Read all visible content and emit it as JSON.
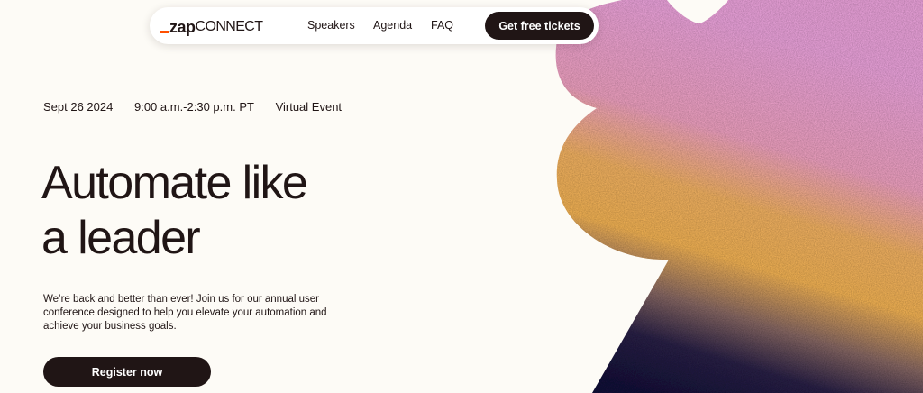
{
  "nav": {
    "logo": {
      "prefix": "zap",
      "suffix": "CONNECT"
    },
    "links": [
      {
        "label": "Speakers"
      },
      {
        "label": "Agenda"
      },
      {
        "label": "FAQ"
      }
    ],
    "cta_label": "Get free tickets"
  },
  "event": {
    "date": "Sept 26 2024",
    "time": "9:00 a.m.-2:30 p.m. PT",
    "format": "Virtual Event"
  },
  "hero": {
    "headline_line1": "Automate like",
    "headline_line2": "a leader",
    "description": "We’re back and better than ever! Join us for our annual user conference designed to help you elevate your automation and achieve your business goals.",
    "register_label": "Register now"
  },
  "colors": {
    "background": "#fdfbf6",
    "text": "#201515",
    "brand_accent": "#ff4f00",
    "art_pink": "#f0a6e0",
    "art_orange": "#f6b15a",
    "art_navy": "#1a1640"
  }
}
